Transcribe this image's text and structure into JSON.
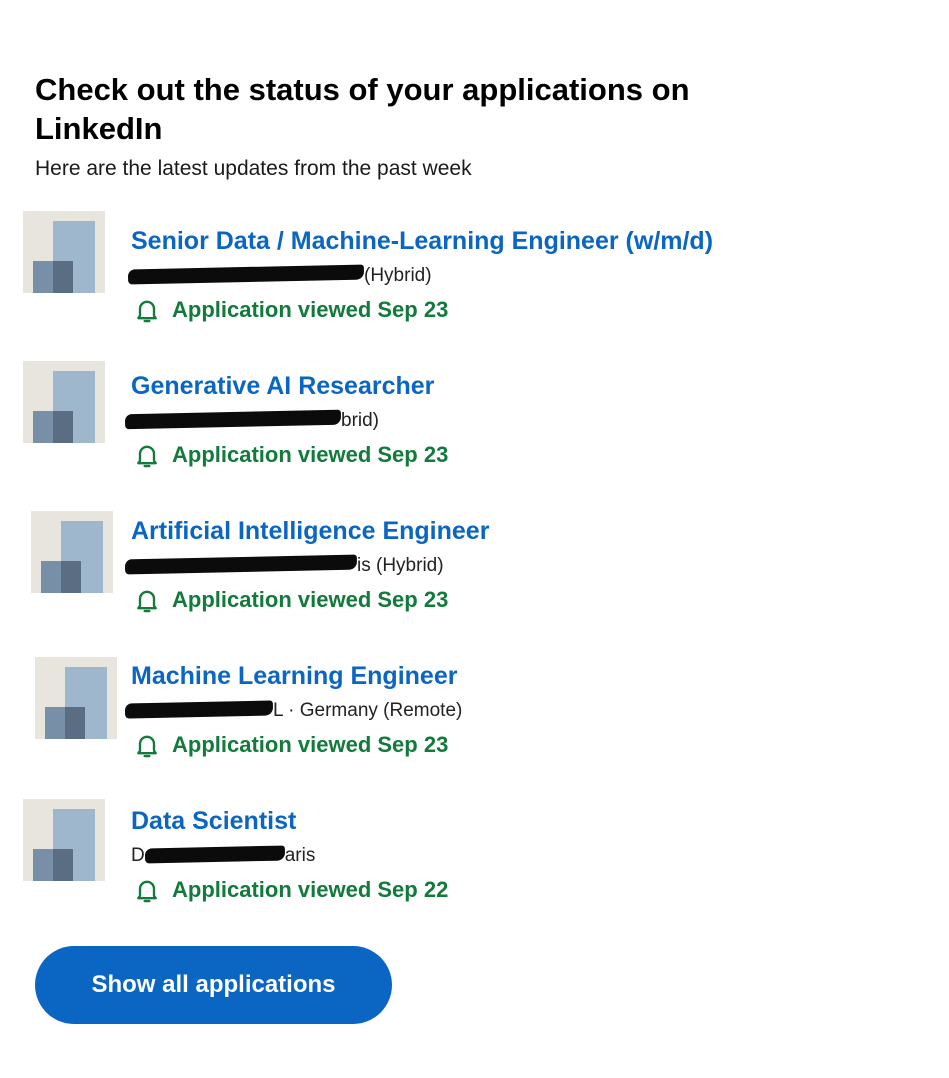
{
  "headline": "Check out the status of your applications on LinkedIn",
  "subhead": "Here are the latest updates from the past week",
  "status_icon": "bell-icon",
  "colors": {
    "link_blue": "#0a66c2",
    "status_green": "#127a3a",
    "button_bg": "#0a66c2",
    "button_text": "#ffffff"
  },
  "jobs": [
    {
      "title": "Senior Data / Machine-Learning Engineer (w/m/d)",
      "company_visible": "(Hybrid)",
      "status": "Application viewed Sep 23"
    },
    {
      "title": "Generative AI Researcher",
      "company_visible": "brid)",
      "status": "Application viewed Sep 23"
    },
    {
      "title": "Artificial Intelligence Engineer",
      "company_visible": "is (Hybrid)",
      "status": "Application viewed Sep 23"
    },
    {
      "title": "Machine Learning Engineer",
      "company_visible": "L · Germany (Remote)",
      "status": "Application viewed Sep 23"
    },
    {
      "title": "Data Scientist",
      "company_prefix": "D",
      "company_visible": "aris",
      "status": "Application viewed Sep 22"
    }
  ],
  "button_label": "Show all applications"
}
